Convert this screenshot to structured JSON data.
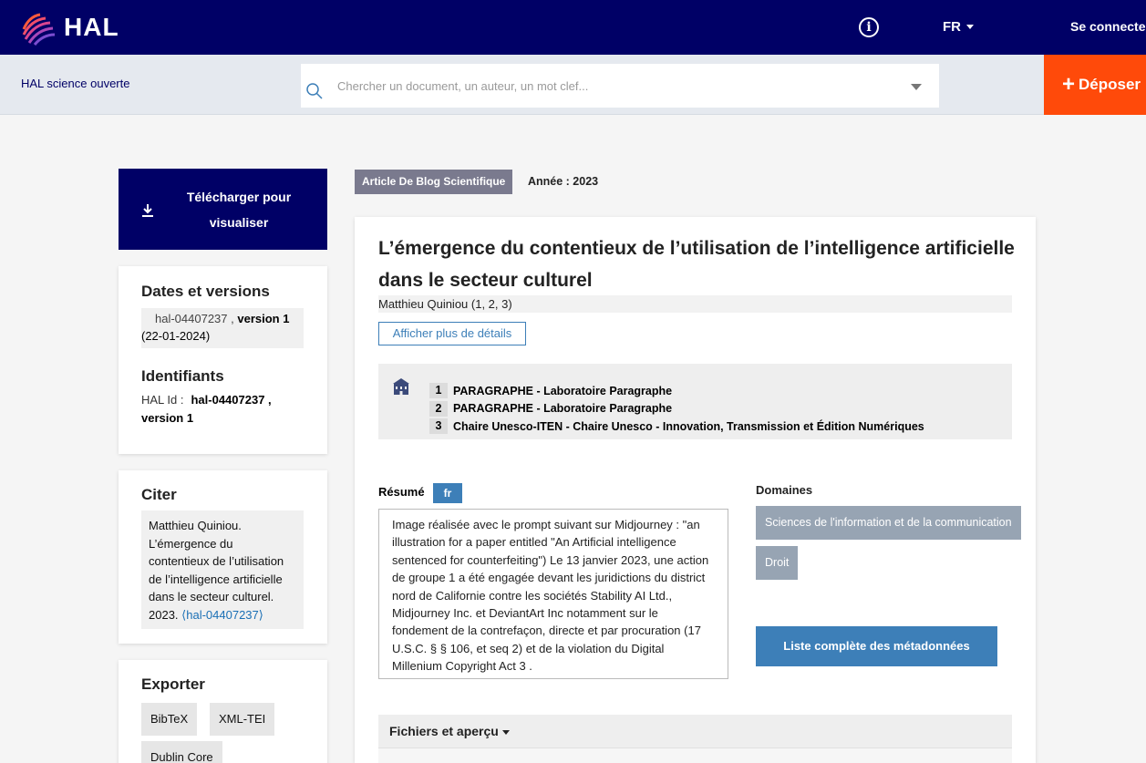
{
  "header": {
    "logo_text": "HAL",
    "language": "FR",
    "login_label": "Se connecter",
    "info_glyph": "i"
  },
  "subbar": {
    "site_name": "HAL science ouverte",
    "search_placeholder": "Chercher un document, un auteur, un mot clef...",
    "deposit_label": "Déposer",
    "deposit_plus": "+"
  },
  "sidebar": {
    "download_label": "Télécharger pour visualiser",
    "dates_title": "Dates et versions",
    "version_id": "hal-04407237 ,",
    "version_label": "version 1",
    "version_date": "(22-01-2024)",
    "identifiers_title": "Identifiants",
    "halid_label": "HAL Id :",
    "halid_value": "hal-04407237 , version 1",
    "cite_title": "Citer",
    "cite_text": "Matthieu Quiniou. L’émergence du contentieux de l’utilisation de l’intelligence artificielle dans le secteur culturel. 2023.",
    "cite_link": "⟨hal-04407237⟩",
    "export_title": "Exporter",
    "export_buttons": [
      "BibTeX",
      "XML-TEI",
      "Dublin Core"
    ]
  },
  "main": {
    "doc_type": "Article De Blog Scientifique",
    "year": "Année : 2023",
    "title": "L’émergence du contentieux de l’utilisation de l’intelligence artificielle dans le secteur culturel",
    "authors": "Matthieu Quiniou (1, 2, 3)",
    "more_details": "Afficher plus de détails",
    "affiliations": [
      {
        "num": "1",
        "name": "PARAGRAPHE - Laboratoire Paragraphe"
      },
      {
        "num": "2",
        "name": "PARAGRAPHE - Laboratoire Paragraphe"
      },
      {
        "num": "3",
        "name": "Chaire Unesco-ITEN - Chaire Unesco - Innovation, Transmission et Édition Numériques"
      }
    ],
    "resume_label": "Résumé",
    "resume_lang": "fr",
    "abstract": "Image réalisée avec le prompt suivant sur Midjourney : \"an illustration for a paper entitled \"An Artificial intelligence sentenced for counterfeiting\") Le 13 janvier 2023, une action de groupe 1 a été engagée devant les juridictions du district nord de Californie contre les sociétés Stability AI Ltd., Midjourney Inc. et DeviantArt Inc notamment sur le fondement de la contrefaçon, directe et par procuration (17 U.S.C. § § 106, et seq 2) et de la violation du Digital Millenium Copyright Act 3 .",
    "domains_label": "Domaines",
    "domains": [
      "Sciences de l'information et de la communication",
      "Droit"
    ],
    "metadata_button": "Liste complète des métadonnées",
    "files_label": "Fichiers et aperçu"
  },
  "colors": {
    "header_bg": "#000066",
    "deposit_bg": "#ff4a0a",
    "accent_blue": "#3d7fb8",
    "domain_tag": "#97a4b3",
    "doc_type_badge": "#7a7a8e"
  },
  "icons": {
    "logo": "hal-swirl-logo",
    "info": "info-icon",
    "search": "search-icon",
    "download": "download-icon",
    "affiliation": "building-icon"
  }
}
